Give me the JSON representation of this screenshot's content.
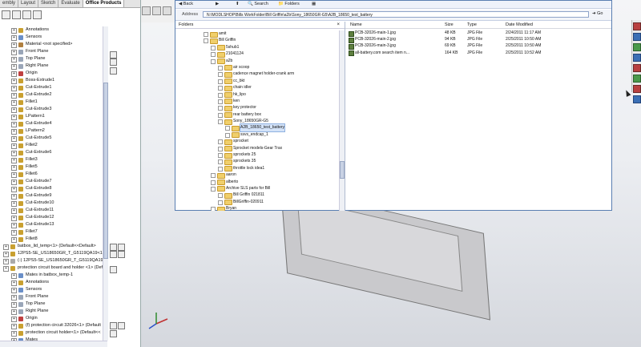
{
  "command_manager": {
    "tabs": [
      "embly",
      "Layout",
      "Sketch",
      "Evaluate",
      "Office Products"
    ],
    "active_tab": "Office Products"
  },
  "feature_tree": {
    "rows": [
      {
        "label": "Annotations",
        "indent": 1,
        "icon": "annotations-icon",
        "color": "#c9a030"
      },
      {
        "label": "Sensors",
        "indent": 1,
        "icon": "sensors-icon",
        "color": "#6a8fc8"
      },
      {
        "label": "Material <not specified>",
        "indent": 1,
        "icon": "material-icon",
        "color": "#b08040"
      },
      {
        "label": "Front Plane",
        "indent": 1,
        "icon": "plane-icon",
        "color": "#9aa6b8"
      },
      {
        "label": "Top Plane",
        "indent": 1,
        "icon": "plane-icon",
        "color": "#9aa6b8"
      },
      {
        "label": "Right Plane",
        "indent": 1,
        "icon": "plane-icon",
        "color": "#9aa6b8"
      },
      {
        "label": "Origin",
        "indent": 1,
        "icon": "origin-icon",
        "color": "#c04040"
      },
      {
        "label": "Boss-Extrude1",
        "indent": 1,
        "icon": "feature-icon",
        "color": "#c9a030"
      },
      {
        "label": "Cut-Extrude1",
        "indent": 1,
        "icon": "feature-icon",
        "color": "#c9a030"
      },
      {
        "label": "Cut-Extrude2",
        "indent": 1,
        "icon": "feature-icon",
        "color": "#c9a030"
      },
      {
        "label": "Fillet1",
        "indent": 1,
        "icon": "fillet-icon",
        "color": "#c9a030"
      },
      {
        "label": "Cut-Extrude3",
        "indent": 1,
        "icon": "feature-icon",
        "color": "#c9a030"
      },
      {
        "label": "LPattern1",
        "indent": 1,
        "icon": "pattern-icon",
        "color": "#c9a030"
      },
      {
        "label": "Cut-Extrude4",
        "indent": 1,
        "icon": "feature-icon",
        "color": "#c9a030"
      },
      {
        "label": "LPattern2",
        "indent": 1,
        "icon": "pattern-icon",
        "color": "#c9a030"
      },
      {
        "label": "Cut-Extrude5",
        "indent": 1,
        "icon": "feature-icon",
        "color": "#c9a030"
      },
      {
        "label": "Fillet2",
        "indent": 1,
        "icon": "fillet-icon",
        "color": "#c9a030"
      },
      {
        "label": "Cut-Extrude6",
        "indent": 1,
        "icon": "feature-icon",
        "color": "#c9a030"
      },
      {
        "label": "Fillet3",
        "indent": 1,
        "icon": "fillet-icon",
        "color": "#c9a030"
      },
      {
        "label": "Fillet5",
        "indent": 1,
        "icon": "fillet-icon",
        "color": "#c9a030"
      },
      {
        "label": "Fillet6",
        "indent": 1,
        "icon": "fillet-icon",
        "color": "#c9a030"
      },
      {
        "label": "Cut-Extrude7",
        "indent": 1,
        "icon": "feature-icon",
        "color": "#c9a030"
      },
      {
        "label": "Cut-Extrude8",
        "indent": 1,
        "icon": "feature-icon",
        "color": "#c9a030"
      },
      {
        "label": "Cut-Extrude9",
        "indent": 1,
        "icon": "feature-icon",
        "color": "#c9a030"
      },
      {
        "label": "Cut-Extrude10",
        "indent": 1,
        "icon": "feature-icon",
        "color": "#c9a030"
      },
      {
        "label": "Cut-Extrude11",
        "indent": 1,
        "icon": "feature-icon",
        "color": "#c9a030"
      },
      {
        "label": "Cut-Extrude12",
        "indent": 1,
        "icon": "feature-icon",
        "color": "#c9a030"
      },
      {
        "label": "Cut-Extrude13",
        "indent": 1,
        "icon": "feature-icon",
        "color": "#c9a030"
      },
      {
        "label": "Fillet7",
        "indent": 1,
        "icon": "fillet-icon",
        "color": "#c9a030"
      },
      {
        "label": "Fillet8",
        "indent": 1,
        "icon": "fillet-icon",
        "color": "#c9a030"
      },
      {
        "label": "batbox_lid_temp<1> (Default<<Default>",
        "indent": 0,
        "icon": "part-icon",
        "color": "#c9a030"
      },
      {
        "label": "12PS5-SE_US18650GR_T_G5119QA19<1>",
        "indent": 0,
        "icon": "part-icon",
        "color": "#c9a030"
      },
      {
        "label": "(-) 12PS5-SE_US18650GR_T_G5119QA19<1>",
        "indent": 0,
        "icon": "part-icon",
        "color": "#aaaaaa"
      },
      {
        "label": "protection circuit board and holder <1> (Def",
        "indent": 0,
        "icon": "assembly-icon",
        "color": "#c9a030"
      },
      {
        "label": "Mates in batbox_temp-1",
        "indent": 1,
        "icon": "mates-icon",
        "color": "#6a8fc8"
      },
      {
        "label": "Annotations",
        "indent": 1,
        "icon": "annotations-icon",
        "color": "#c9a030"
      },
      {
        "label": "Sensors",
        "indent": 1,
        "icon": "sensors-icon",
        "color": "#6a8fc8"
      },
      {
        "label": "Front Plane",
        "indent": 1,
        "icon": "plane-icon",
        "color": "#9aa6b8"
      },
      {
        "label": "Top Plane",
        "indent": 1,
        "icon": "plane-icon",
        "color": "#9aa6b8"
      },
      {
        "label": "Right Plane",
        "indent": 1,
        "icon": "plane-icon",
        "color": "#9aa6b8"
      },
      {
        "label": "Origin",
        "indent": 1,
        "icon": "origin-icon",
        "color": "#c04040"
      },
      {
        "label": "(f) protection circuit 32026<1> (Default",
        "indent": 1,
        "icon": "part-icon",
        "color": "#c9a030"
      },
      {
        "label": "protection circuit holder<1> (Default<<",
        "indent": 1,
        "icon": "part-icon",
        "color": "#c9a030"
      },
      {
        "label": "Mates",
        "indent": 1,
        "icon": "mates-icon",
        "color": "#6a8fc8"
      }
    ]
  },
  "explorer": {
    "toolbar": {
      "back": "Back",
      "search": "Search",
      "folders": "Folders"
    },
    "address_label": "Address",
    "address_value": "N:\\MODLSHOP\\Bills WorkFolder\\Bill Griffin\\a2b\\Sony_18650GR-G5\\A2B_18650_test_battery",
    "go": "Go",
    "folders_pane_title": "Folders",
    "folder_tree": [
      {
        "label": "amit",
        "indent": 3,
        "expander": true
      },
      {
        "label": "Bill Griffin",
        "indent": 3,
        "expander": true
      },
      {
        "label": "5shub1",
        "indent": 4,
        "expander": true
      },
      {
        "label": "21041124",
        "indent": 4,
        "expander": true
      },
      {
        "label": "a2b",
        "indent": 4,
        "expander": true
      },
      {
        "label": "air scoop",
        "indent": 5,
        "expander": true
      },
      {
        "label": "cadence magnet holder-crank arm",
        "indent": 5,
        "expander": true
      },
      {
        "label": "cc_bkt",
        "indent": 5,
        "expander": true
      },
      {
        "label": "chain idler",
        "indent": 5,
        "expander": true
      },
      {
        "label": "hk_lipo",
        "indent": 5,
        "expander": true
      },
      {
        "label": "ken",
        "indent": 5,
        "expander": true
      },
      {
        "label": "key protector",
        "indent": 5,
        "expander": true
      },
      {
        "label": "rear battery box",
        "indent": 5,
        "expander": true
      },
      {
        "label": "Sony_18650GR-G5",
        "indent": 5,
        "expander": true
      },
      {
        "label": "A2B_18650_test_battery",
        "indent": 6,
        "expander": true,
        "selected": true
      },
      {
        "label": "ssvs_endcap_1",
        "indent": 6,
        "expander": true
      },
      {
        "label": "sprocket",
        "indent": 5,
        "expander": true
      },
      {
        "label": "Sprocket models-Gear Trax",
        "indent": 5,
        "expander": true
      },
      {
        "label": "sprockets 25",
        "indent": 5,
        "expander": true
      },
      {
        "label": "sprockets 35",
        "indent": 5,
        "expander": true
      },
      {
        "label": "throttle lock idea1",
        "indent": 5,
        "expander": true
      },
      {
        "label": "aaron",
        "indent": 4,
        "expander": true
      },
      {
        "label": "alberto",
        "indent": 4,
        "expander": true
      },
      {
        "label": "Archive SLS parts for Bill",
        "indent": 4,
        "expander": true
      },
      {
        "label": "Bill Griffin 021811",
        "indent": 5,
        "expander": true
      },
      {
        "label": "BillGriffin-020911",
        "indent": 5,
        "expander": true
      },
      {
        "label": "Bryan",
        "indent": 4,
        "expander": true
      }
    ],
    "file_columns": {
      "name": "Name",
      "size": "Size",
      "type": "Type",
      "modified": "Date Modified"
    },
    "files": [
      {
        "name": "PCB-32026-main-1.jpg",
        "size": "48 KB",
        "type": "JPG File",
        "modified": "2/24/2011 11:17 AM"
      },
      {
        "name": "PCB-32026-main-2.jpg",
        "size": "94 KB",
        "type": "JPG File",
        "modified": "2/25/2011 10:50 AM"
      },
      {
        "name": "PCB-32026-main-3.jpg",
        "size": "69 KB",
        "type": "JPG File",
        "modified": "2/25/2011 10:50 AM"
      },
      {
        "name": "all-battery.com search item n...",
        "size": "164 KB",
        "type": "JPG File",
        "modified": "2/25/2011 10:52 AM"
      }
    ]
  }
}
